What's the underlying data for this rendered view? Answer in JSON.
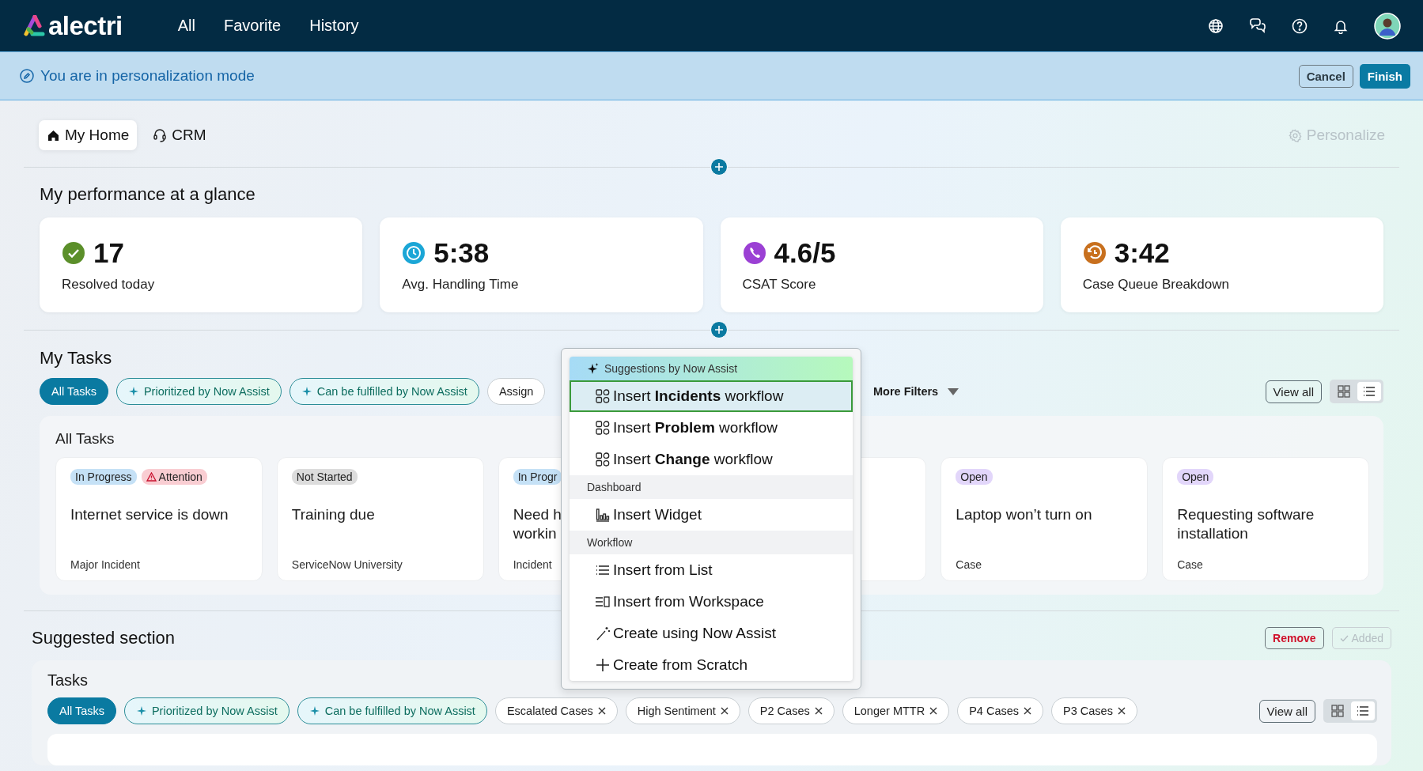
{
  "top_nav": {
    "logo": "alectri",
    "links": [
      "All",
      "Favorite",
      "History"
    ]
  },
  "banner": {
    "message": "You are in personalization mode",
    "cancel": "Cancel",
    "finish": "Finish"
  },
  "page_tabs": [
    {
      "label": "My Home",
      "kind": "home",
      "selected": true
    },
    {
      "label": "CRM",
      "kind": "headset",
      "selected": false
    }
  ],
  "personalize": {
    "label": "Personalize",
    "disabled": true
  },
  "performance": {
    "title": "My performance at a glance",
    "metrics": [
      {
        "value": "17",
        "label": "Resolved today",
        "kind": "check",
        "color": "#5b8f2a"
      },
      {
        "value": "5:38",
        "label": "Avg. Handling Time",
        "kind": "clock",
        "color": "#1ba6d6"
      },
      {
        "value": "4.6/5",
        "label": "CSAT Score",
        "kind": "phone",
        "color": "#9b40d4"
      },
      {
        "value": "3:42",
        "label": "Case Queue Breakdown",
        "kind": "timer",
        "color": "#c8701e"
      }
    ]
  },
  "my_tasks": {
    "title": "My Tasks",
    "filters": [
      {
        "label": "All Tasks",
        "kind": "plain",
        "selected": true
      },
      {
        "label": "Prioritized by Now Assist",
        "kind": "assist",
        "selected": false
      },
      {
        "label": "Can be fulfilled by Now Assist",
        "kind": "assist",
        "selected": false
      },
      {
        "label": "Assign",
        "kind": "plain",
        "selected": false
      }
    ],
    "more_filters": "More Filters",
    "view_all": "View all",
    "view_modes": [
      {
        "kind": "grid",
        "selected": false
      },
      {
        "kind": "list",
        "selected": true
      }
    ],
    "panel": {
      "title": "All Tasks",
      "cards": [
        {
          "tags": [
            {
              "label": "In Progress",
              "kind": "progress"
            },
            {
              "label": "Attention",
              "kind": "attention"
            }
          ],
          "title": "Internet service is down",
          "category": "Major Incident"
        },
        {
          "tags": [
            {
              "label": "Not Started",
              "kind": "not_started"
            }
          ],
          "title": "Training due",
          "category": "ServiceNow University"
        },
        {
          "tags": [
            {
              "label": "In Progr",
              "kind": "progress"
            }
          ],
          "title": "Need h\nworkin",
          "category": "Incident"
        },
        {
          "tags": [
            {
              "label": "Open",
              "kind": "open"
            }
          ],
          "title": "Laptop won’t turn on",
          "category": "Case"
        },
        {
          "tags": [
            {
              "label": "Open",
              "kind": "open"
            }
          ],
          "title": "Requesting software installation",
          "category": "Case"
        }
      ]
    }
  },
  "suggested": {
    "title": "Suggested section",
    "remove": "Remove",
    "added": {
      "label": "Added",
      "disabled": true
    },
    "panel": {
      "title": "Tasks",
      "filters": [
        {
          "label": "All Tasks",
          "kind": "plain",
          "selected": true
        },
        {
          "label": "Prioritized by Now Assist",
          "kind": "assist",
          "selected": false
        },
        {
          "label": "Can be fulfilled by Now Assist",
          "kind": "assist",
          "selected": false
        },
        {
          "label": "Escalated Cases",
          "kind": "removable",
          "selected": false
        },
        {
          "label": "High Sentiment",
          "kind": "removable",
          "selected": false
        },
        {
          "label": "P2 Cases",
          "kind": "removable",
          "selected": false
        },
        {
          "label": "Longer MTTR",
          "kind": "removable",
          "selected": false
        },
        {
          "label": "P4 Cases",
          "kind": "removable",
          "selected": false
        },
        {
          "label": "P3 Cases",
          "kind": "removable",
          "selected": false
        }
      ],
      "view_all": "View all",
      "view_modes": [
        {
          "kind": "grid",
          "selected": false
        },
        {
          "kind": "list",
          "selected": true
        }
      ]
    }
  },
  "insert_menu": {
    "sections": [
      {
        "kind": "assist",
        "header": "Suggestions by Now Assist",
        "items": [
          {
            "label": "Insert **Incidents** workflow",
            "kind": "workflow",
            "selected": true
          },
          {
            "label": "Insert **Problem** workflow",
            "kind": "workflow",
            "selected": false
          },
          {
            "label": "Insert **Change** workflow",
            "kind": "workflow",
            "selected": false
          }
        ]
      },
      {
        "kind": "plain",
        "header": "Dashboard",
        "items": [
          {
            "label": "Insert Widget",
            "kind": "widget",
            "selected": false
          }
        ]
      },
      {
        "kind": "plain",
        "header": "Workflow",
        "items": [
          {
            "label": "Insert from List",
            "kind": "list",
            "selected": false
          },
          {
            "label": "Insert from Workspace",
            "kind": "workspace",
            "selected": false
          },
          {
            "label": "Create using Now Assist",
            "kind": "wand",
            "selected": false
          },
          {
            "label": "Create from Scratch",
            "kind": "plus",
            "selected": false
          }
        ]
      }
    ]
  }
}
